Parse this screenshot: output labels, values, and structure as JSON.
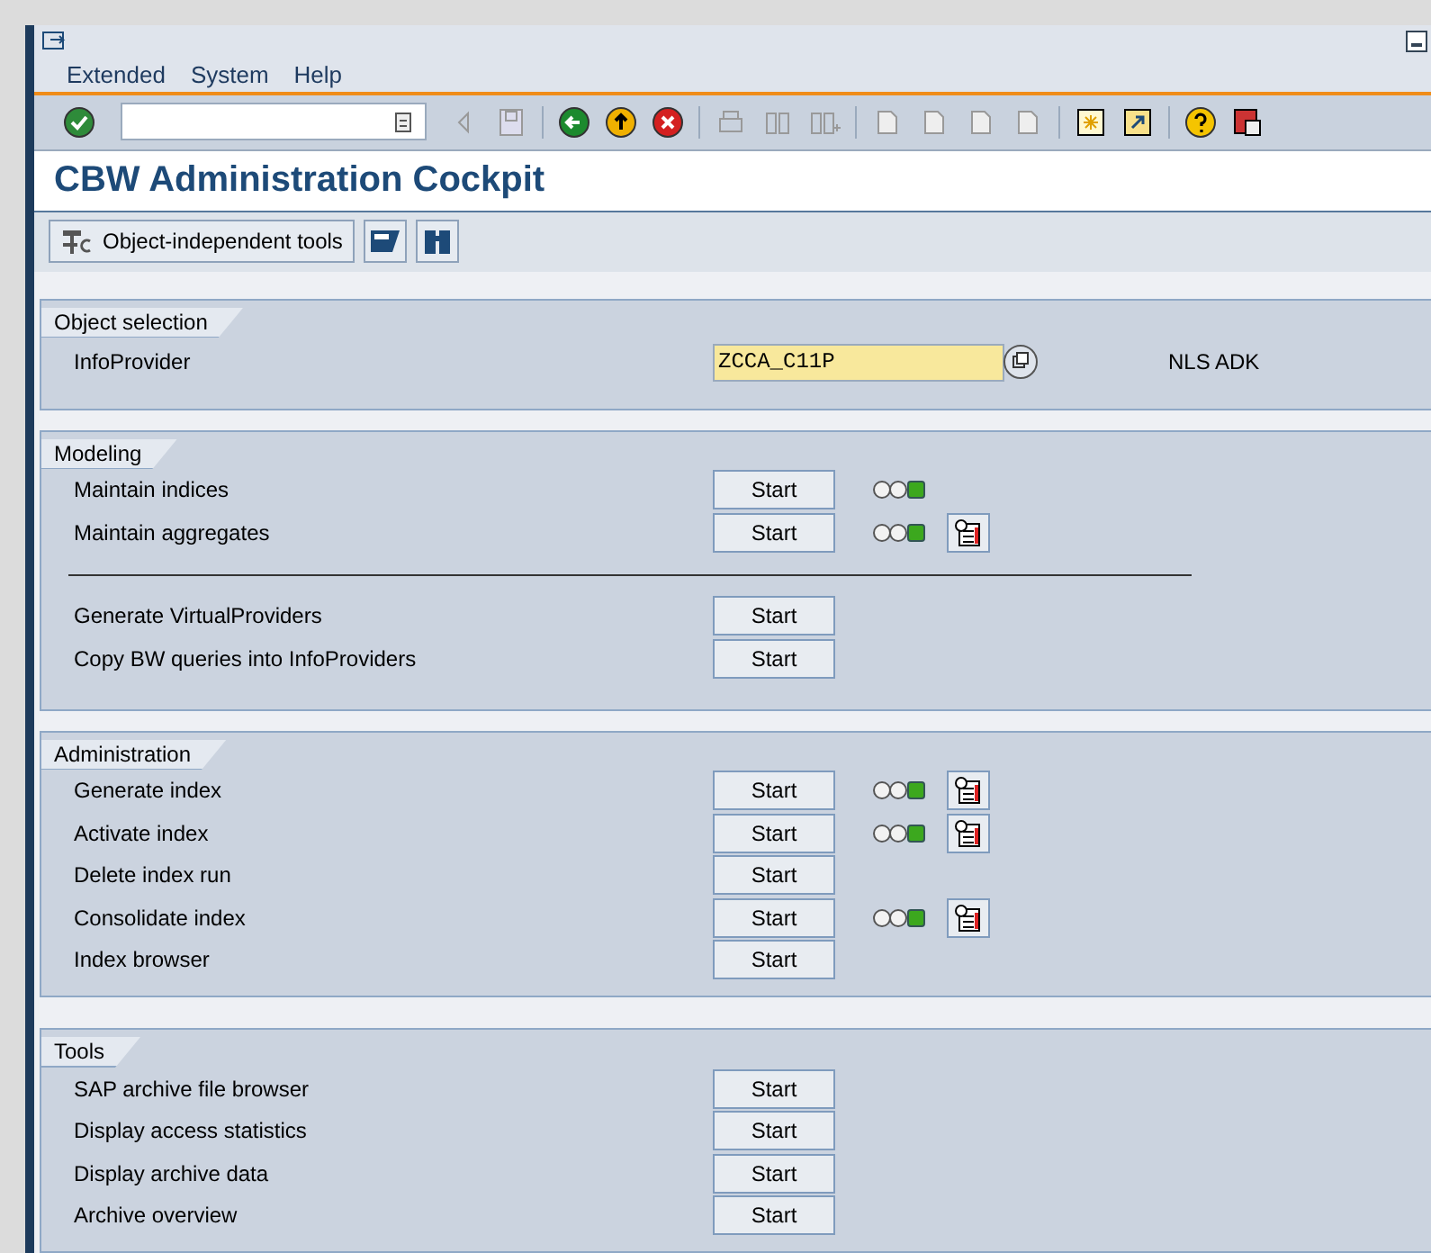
{
  "menu": [
    {
      "label": "Extended",
      "selected": false
    },
    {
      "label": "System",
      "selected": false
    },
    {
      "label": "Help",
      "selected": false
    }
  ],
  "title": "CBW Administration Cockpit",
  "app_toolbar": {
    "button": "Object-independent tools"
  },
  "object_selection": {
    "heading": "Object selection",
    "label": "InfoProvider",
    "value": "ZCCA_C11P",
    "description": "NLS ADK"
  },
  "groups": [
    {
      "heading": "Modeling",
      "rows": [
        {
          "kind": "action",
          "label": "Maintain indices",
          "button": "Start",
          "light": true,
          "log": false
        },
        {
          "kind": "action",
          "label": "Maintain aggregates",
          "button": "Start",
          "light": true,
          "log": true
        },
        {
          "kind": "separator"
        },
        {
          "kind": "action",
          "label": "Generate VirtualProviders",
          "button": "Start",
          "light": false,
          "log": false
        },
        {
          "kind": "action",
          "label": "Copy BW queries into InfoProviders",
          "button": "Start",
          "light": false,
          "log": false
        }
      ]
    },
    {
      "heading": "Administration",
      "rows": [
        {
          "kind": "action",
          "label": "Generate index",
          "button": "Start",
          "light": true,
          "log": true
        },
        {
          "kind": "action",
          "label": "Activate index",
          "button": "Start",
          "light": true,
          "log": true
        },
        {
          "kind": "action",
          "label": "Delete index run",
          "button": "Start",
          "light": false,
          "log": false
        },
        {
          "kind": "action",
          "label": "Consolidate index",
          "button": "Start",
          "light": true,
          "log": true
        },
        {
          "kind": "action",
          "label": "Index browser",
          "button": "Start",
          "light": false,
          "log": false
        }
      ]
    },
    {
      "heading": "Tools",
      "rows": [
        {
          "kind": "action",
          "label": "SAP archive file browser",
          "button": "Start",
          "light": false,
          "log": false
        },
        {
          "kind": "action",
          "label": "Display access statistics",
          "button": "Start",
          "light": false,
          "log": false
        },
        {
          "kind": "action",
          "label": "Display archive data",
          "button": "Start",
          "light": false,
          "log": false
        },
        {
          "kind": "action",
          "label": "Archive overview",
          "button": "Start",
          "light": false,
          "log": false
        }
      ]
    }
  ]
}
